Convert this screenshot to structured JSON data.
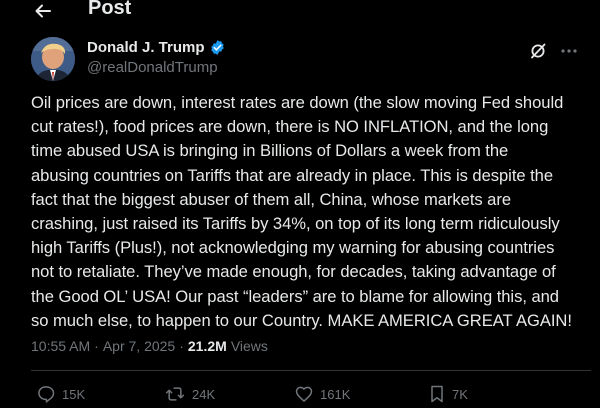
{
  "header": {
    "title": "Post"
  },
  "author": {
    "display_name": "Donald J. Trump",
    "handle": "@realDonaldTrump",
    "verified": true,
    "verified_color": "#1d9bf0"
  },
  "post": {
    "text": "Oil prices are down, interest rates are down (the slow moving Fed should\ncut rates!), food prices are down, there is NO INFLATION, and the long\ntime abused USA is bringing in Billions of Dollars a week from the\nabusing countries on Tariffs that are already in place. This is despite the\nfact that the biggest abuser of them all, China, whose markets are\ncrashing, just raised its Tariffs by 34%, on top of its long term ridiculously\nhigh Tariffs (Plus!), not acknowledging my warning for abusing countries\nnot to retaliate. They’ve made enough, for decades, taking advantage of\nthe Good OL’ USA! Our past “leaders” are to blame for allowing this, and\nso much else, to happen to our Country. MAKE AMERICA GREAT AGAIN!",
    "time": "10:55 AM",
    "separator": "·",
    "date": "Apr 7, 2025",
    "views_count": "21.2M",
    "views_label": "Views"
  },
  "actions": {
    "replies": "15K",
    "reposts": "24K",
    "likes": "161K",
    "bookmarks": "7K"
  },
  "colors": {
    "background": "#000000",
    "text": "#e7e9ea",
    "muted": "#71767b",
    "divider": "#2f3336"
  }
}
